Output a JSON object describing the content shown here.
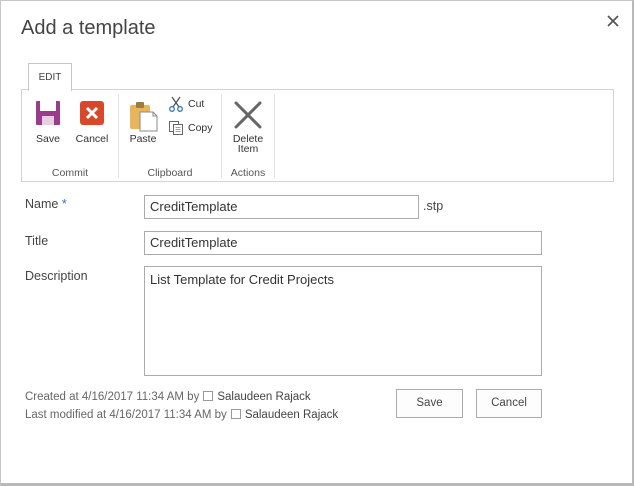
{
  "dialog": {
    "title": "Add a template",
    "close_icon": "close-icon"
  },
  "ribbon": {
    "tab_label": "EDIT",
    "groups": {
      "commit": {
        "label": "Commit",
        "save": "Save",
        "cancel": "Cancel"
      },
      "clipboard": {
        "label": "Clipboard",
        "paste": "Paste",
        "cut": "Cut",
        "copy": "Copy"
      },
      "actions": {
        "label": "Actions",
        "delete_line1": "Delete",
        "delete_line2": "Item"
      }
    }
  },
  "form": {
    "name_label": "Name",
    "required_marker": "*",
    "name_value": "CreditTemplate",
    "name_suffix": ".stp",
    "title_label": "Title",
    "title_value": "CreditTemplate",
    "description_label": "Description",
    "description_value": "List Template for Credit Projects"
  },
  "footer": {
    "created_text": "Created at 4/16/2017 11:34 AM  by",
    "created_user": "Salaudeen Rajack",
    "modified_text": "Last modified at 4/16/2017 11:34 AM  by",
    "modified_user": "Salaudeen Rajack",
    "save_button": "Save",
    "cancel_button": "Cancel"
  },
  "colors": {
    "save_icon": "#9b3b8e",
    "cancel_icon": "#d9472b",
    "paste_icon": "#e8b55b",
    "required": "#2b79c2"
  }
}
